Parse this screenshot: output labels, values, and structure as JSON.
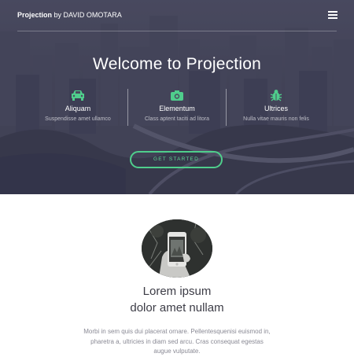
{
  "nav": {
    "brand_name": "Projection",
    "brand_by": "by DAVID OMOTARA",
    "menu_icon": "hamburger-menu-icon"
  },
  "hero": {
    "title": "Welcome to Projection",
    "features": [
      {
        "icon": "car-icon",
        "title": "Aliquam",
        "subtitle": "Suspendisse amet ullamco"
      },
      {
        "icon": "camera-icon",
        "title": "Elementum",
        "subtitle": "Class aptent taciti ad litora"
      },
      {
        "icon": "bug-icon",
        "title": "Ultrices",
        "subtitle": "Nulla vitae mauris non felis"
      }
    ],
    "cta_label": "GET STARTED"
  },
  "content": {
    "lead_line1": "Lorem ipsum",
    "lead_line2": "dolor amet nullam",
    "body": "Morbi in sem quis dui placerat ornare. Pellentesquenisi euismod in, pharetra a, ultricies in diam sed arcu. Cras consequat egestas augue vulputate."
  },
  "colors": {
    "accent_green": "#4fce8c",
    "hero_overlay": "#4a4b5e"
  }
}
